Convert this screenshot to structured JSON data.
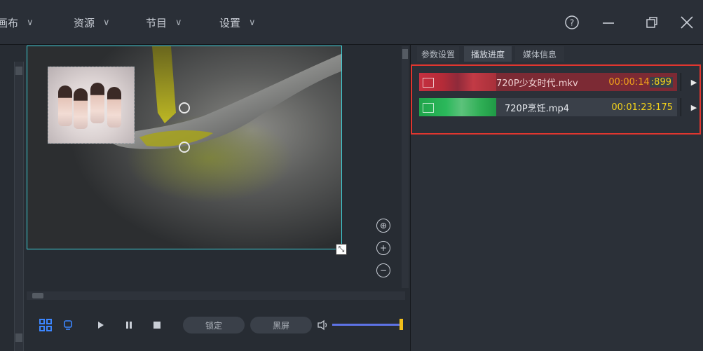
{
  "menu": {
    "items": [
      {
        "label": "画布"
      },
      {
        "label": "资源"
      },
      {
        "label": "节目"
      },
      {
        "label": "设置"
      }
    ]
  },
  "window_controls": {
    "help": "help-icon",
    "minimize": "minimize-icon",
    "restore": "restore-icon",
    "close": "close-icon"
  },
  "tabs": [
    {
      "label": "参数设置",
      "active": false
    },
    {
      "label": "播放进度",
      "active": true
    },
    {
      "label": "媒体信息",
      "active": false
    }
  ],
  "media_list": [
    {
      "name": "720P少女时代.mkv",
      "time_main": "00:00:14",
      "time_ms": ":899",
      "state": "playing",
      "color": "#b3282f"
    },
    {
      "name": "720P烹饪.mp4",
      "time_main": "00:01:23:175",
      "time_ms": "",
      "state": "queued",
      "color": "#26a14a"
    }
  ],
  "player": {
    "lock_label": "锁定",
    "black_label": "黑屏",
    "volume": 1.0
  },
  "colors": {
    "accent_cyan": "#3fd0d8",
    "highlight_red": "#e0362f",
    "volume_track": "#5e73e6",
    "volume_thumb": "#f3c01a",
    "time_yellow": "#f3d21a"
  }
}
